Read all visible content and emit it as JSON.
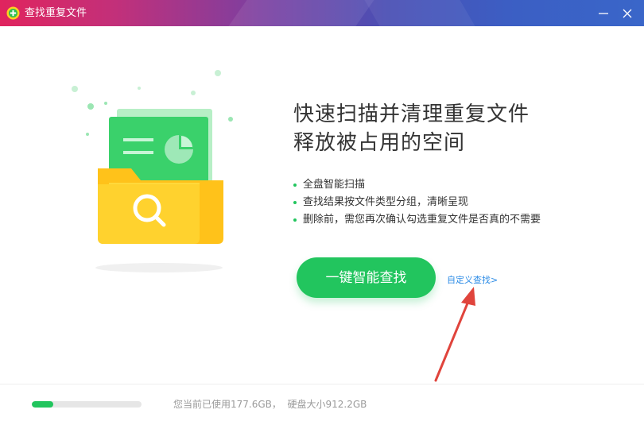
{
  "window": {
    "title": "查找重复文件",
    "controls": {
      "minimize_icon": "minimize-icon",
      "close_icon": "close-icon"
    }
  },
  "headline": {
    "line1": "快速扫描并清理重复文件",
    "line2": "释放被占用的空间"
  },
  "features": [
    "全盘智能扫描",
    "查找结果按文件类型分组，清晰呈现",
    "删除前，需您再次确认勾选重复文件是否真的不需要"
  ],
  "actions": {
    "scan_button": "一键智能查找",
    "custom_search_link": "自定义查找>"
  },
  "footer": {
    "disk_used_text": "您当前已使用177.6GB，",
    "disk_total_text": "硬盘大小912.2GB",
    "disk_usage_fraction": 0.195
  },
  "colors": {
    "accent": "#22c55e",
    "link": "#2b8be6",
    "arrow": "#e0443c"
  }
}
